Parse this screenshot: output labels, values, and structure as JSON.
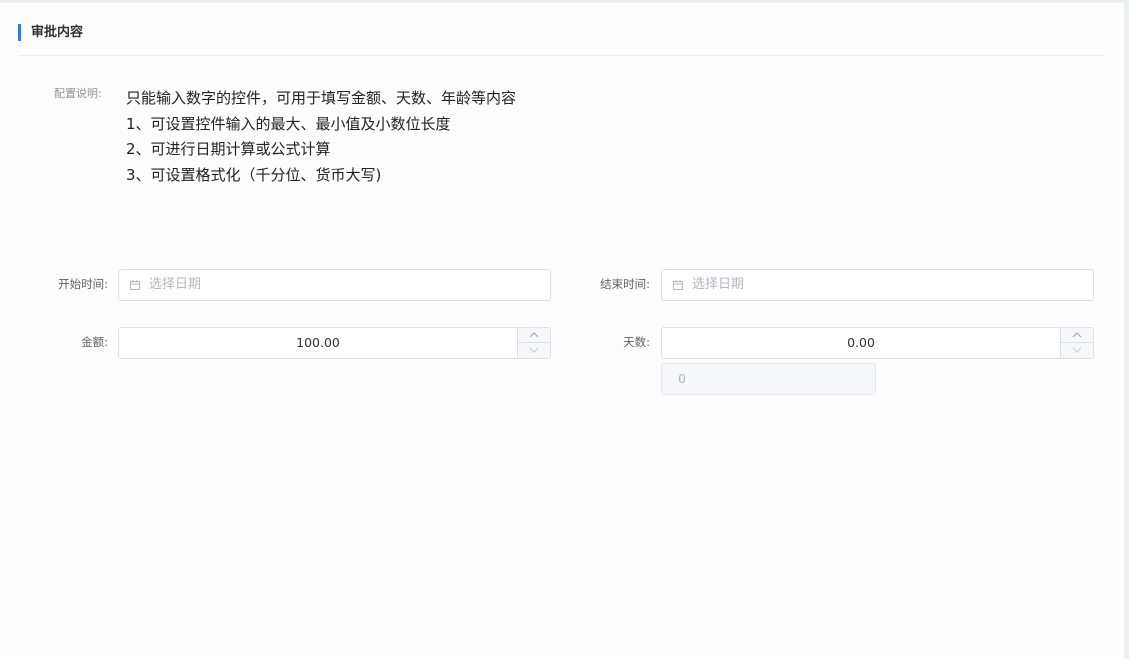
{
  "section": {
    "title": "审批内容"
  },
  "config": {
    "label": "配置说明:",
    "lines": [
      "只能输入数字的控件，可用于填写金额、天数、年龄等内容",
      "1、可设置控件输入的最大、最小值及小数位长度",
      "2、可进行日期计算或公式计算",
      "3、可设置格式化（千分位、货币大写)"
    ]
  },
  "form": {
    "start_time": {
      "label": "开始时间:",
      "placeholder": "选择日期"
    },
    "end_time": {
      "label": "结束时间:",
      "placeholder": "选择日期"
    },
    "amount": {
      "label": "金额:",
      "value": "100.00"
    },
    "days": {
      "label": "天数:",
      "value": "0.00",
      "computed": "0"
    }
  },
  "colors": {
    "accent": "#2d7df6",
    "border": "#dcdfe6",
    "label": "#606266"
  },
  "icons": {
    "date": "calendar-icon",
    "step_up": "chevron-up-icon",
    "step_down": "chevron-down-icon"
  }
}
